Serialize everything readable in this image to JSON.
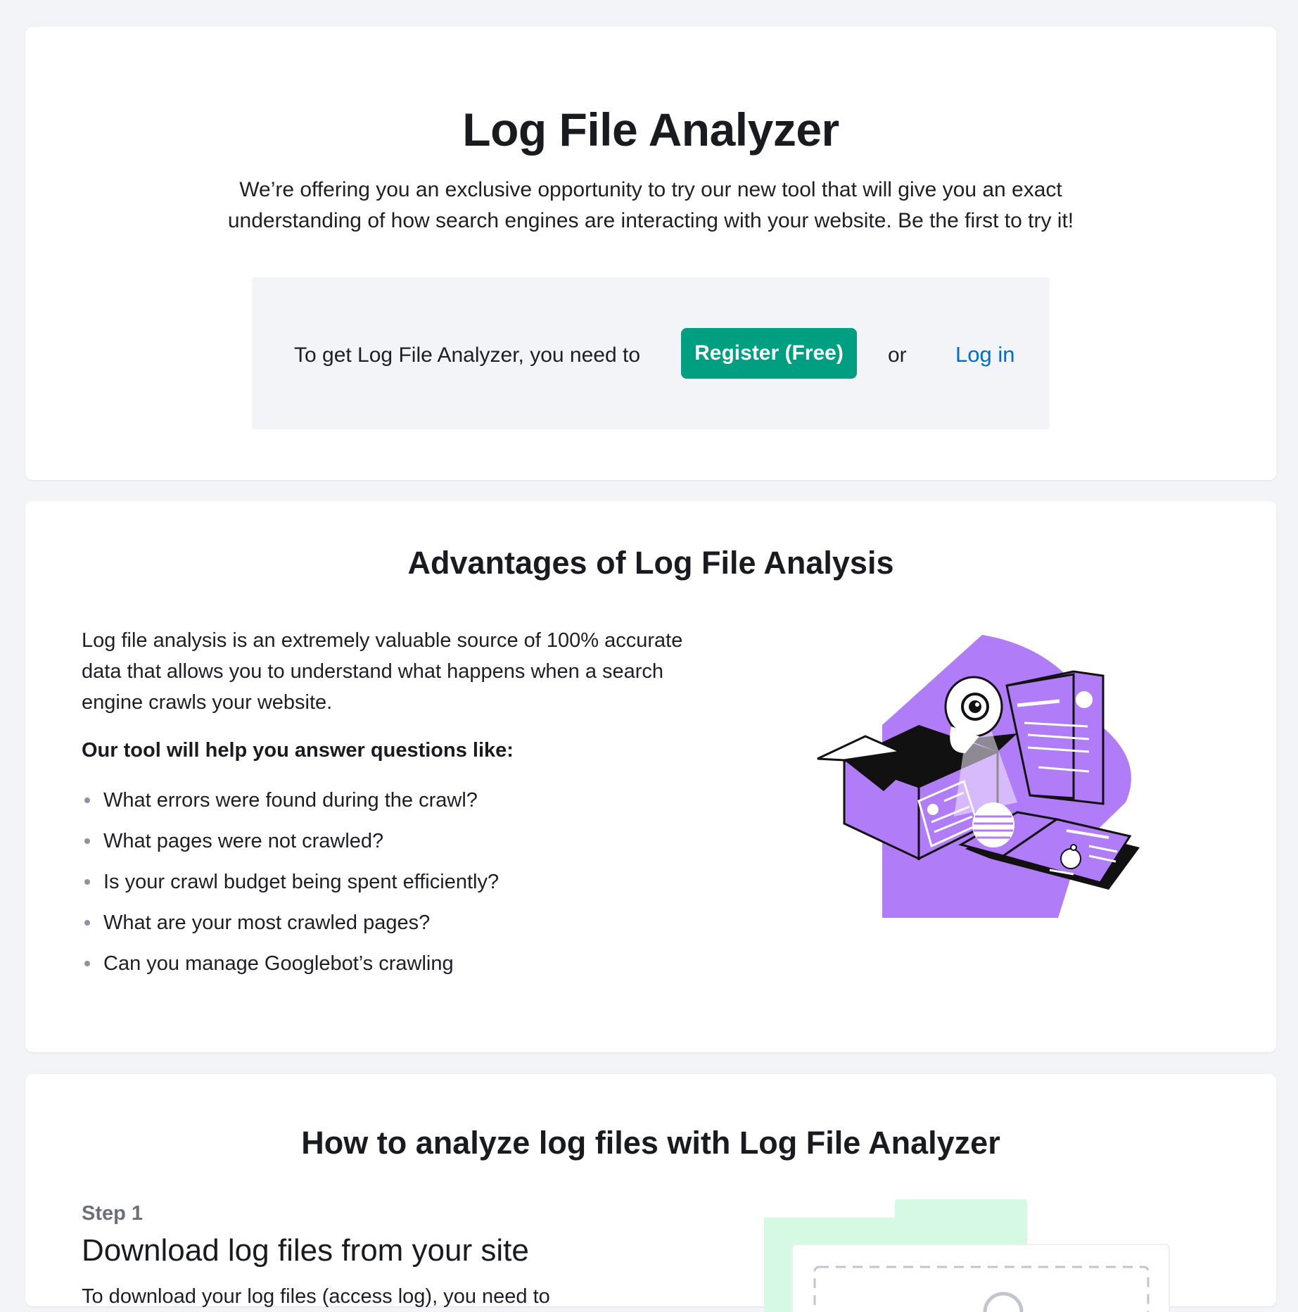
{
  "hero": {
    "title": "Log File Analyzer",
    "subtitle": "We’re offering you an exclusive opportunity to try our new tool that will give you an exact understanding of how search engines are interacting with your website. Be the first to try it!",
    "cta_text": "To get Log File Analyzer, you need to",
    "register_label": "Register (Free)",
    "or_text": "or",
    "login_label": "Log in"
  },
  "advantages": {
    "title": "Advantages of Log File Analysis",
    "intro": "Log file analysis is an extremely valuable source of 100% accurate data that allows you to understand what happens when a search engine crawls your website.",
    "lead": "Our tool will help you answer questions like:",
    "questions": [
      "What errors were found during the crawl?",
      "What pages were not crawled?",
      "Is your crawl budget being spent efficiently?",
      "What are your most crawled pages?",
      "Can you manage Googlebot’s crawling"
    ]
  },
  "how_to": {
    "title": "How to analyze log files with Log File Analyzer",
    "step_label": "Step 1",
    "step_title": "Download log files from your site",
    "step_desc": "To download your log files (access log), you need to"
  },
  "colors": {
    "accent_green": "#009f81",
    "link_blue": "#006dca",
    "illustration_purple": "#b07cf7",
    "page_bg": "#f3f4f8"
  }
}
